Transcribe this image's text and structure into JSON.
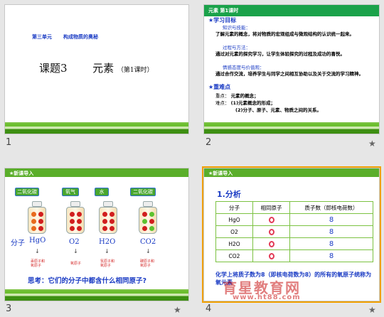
{
  "slides": [
    {
      "number": "1",
      "unit": "第三单元",
      "unit_topic": "构成物质的奥秘",
      "title": "课题3",
      "title_main": "元素",
      "title_sub": "（第1课时）"
    },
    {
      "number": "2",
      "header": "元素    第1课时",
      "objectives_heading": "★学习目标",
      "knowledge_label": "知识与技能：",
      "knowledge_text": "了解元素的概念，将对物质的宏观组成与微观结构的认识统一起来。",
      "process_label": "过程与方法：",
      "process_text": "通过对元素的探究学习，让学生体验探究的过程及成功的喜悦。",
      "emotion_label": "情感态度与价值观：",
      "emotion_text": "通过合作交流，培养学生与同学之间相互协助以及关于交流的学习精神。",
      "keypoints_heading": "★重难点",
      "key_label": "重点：",
      "key_text": "元素的概念；",
      "difficult_label": "难点：",
      "difficult_1": "(1)元素概念的形成；",
      "difficult_2": "(2)分子、原子、元素、物质之间的关系。",
      "starred": true
    },
    {
      "number": "3",
      "header": "★新课导入",
      "tags": [
        "二氧化碳",
        "氧气",
        "水",
        "二氧化碳"
      ],
      "molecule_label": "分子",
      "formulas": [
        "HgO",
        "O2",
        "H2O",
        "CO2"
      ],
      "notes": [
        [
          "汞原子和",
          "氧原子"
        ],
        [
          "氧原子"
        ],
        [
          "氢原子和",
          "氧原子"
        ],
        [
          "碳原子和",
          "氧原子"
        ]
      ],
      "question": "思考：它们的分子中都含什么相同原子?",
      "starred": true
    },
    {
      "number": "4",
      "header": "★新课导入",
      "section": "1.分析",
      "columns": [
        "分子",
        "相同原子",
        "质子数（即核电荷数）"
      ],
      "rows": [
        {
          "molecule": "HgO",
          "proton": "8"
        },
        {
          "molecule": "O2",
          "proton": "8"
        },
        {
          "molecule": "H2O",
          "proton": "8"
        },
        {
          "molecule": "CO2",
          "proton": "8"
        }
      ],
      "conclusion": "化学上将质子数为8（即核电荷数为8）的所有的氧原子统称为氧元素",
      "watermark": "育星教育网",
      "watermark_url": "www.ht88.com",
      "starred": true
    }
  ],
  "colors": {
    "accent_green": "#7cc242",
    "title_blue": "#1a3bc4",
    "highlight_red": "#d11e1e"
  }
}
